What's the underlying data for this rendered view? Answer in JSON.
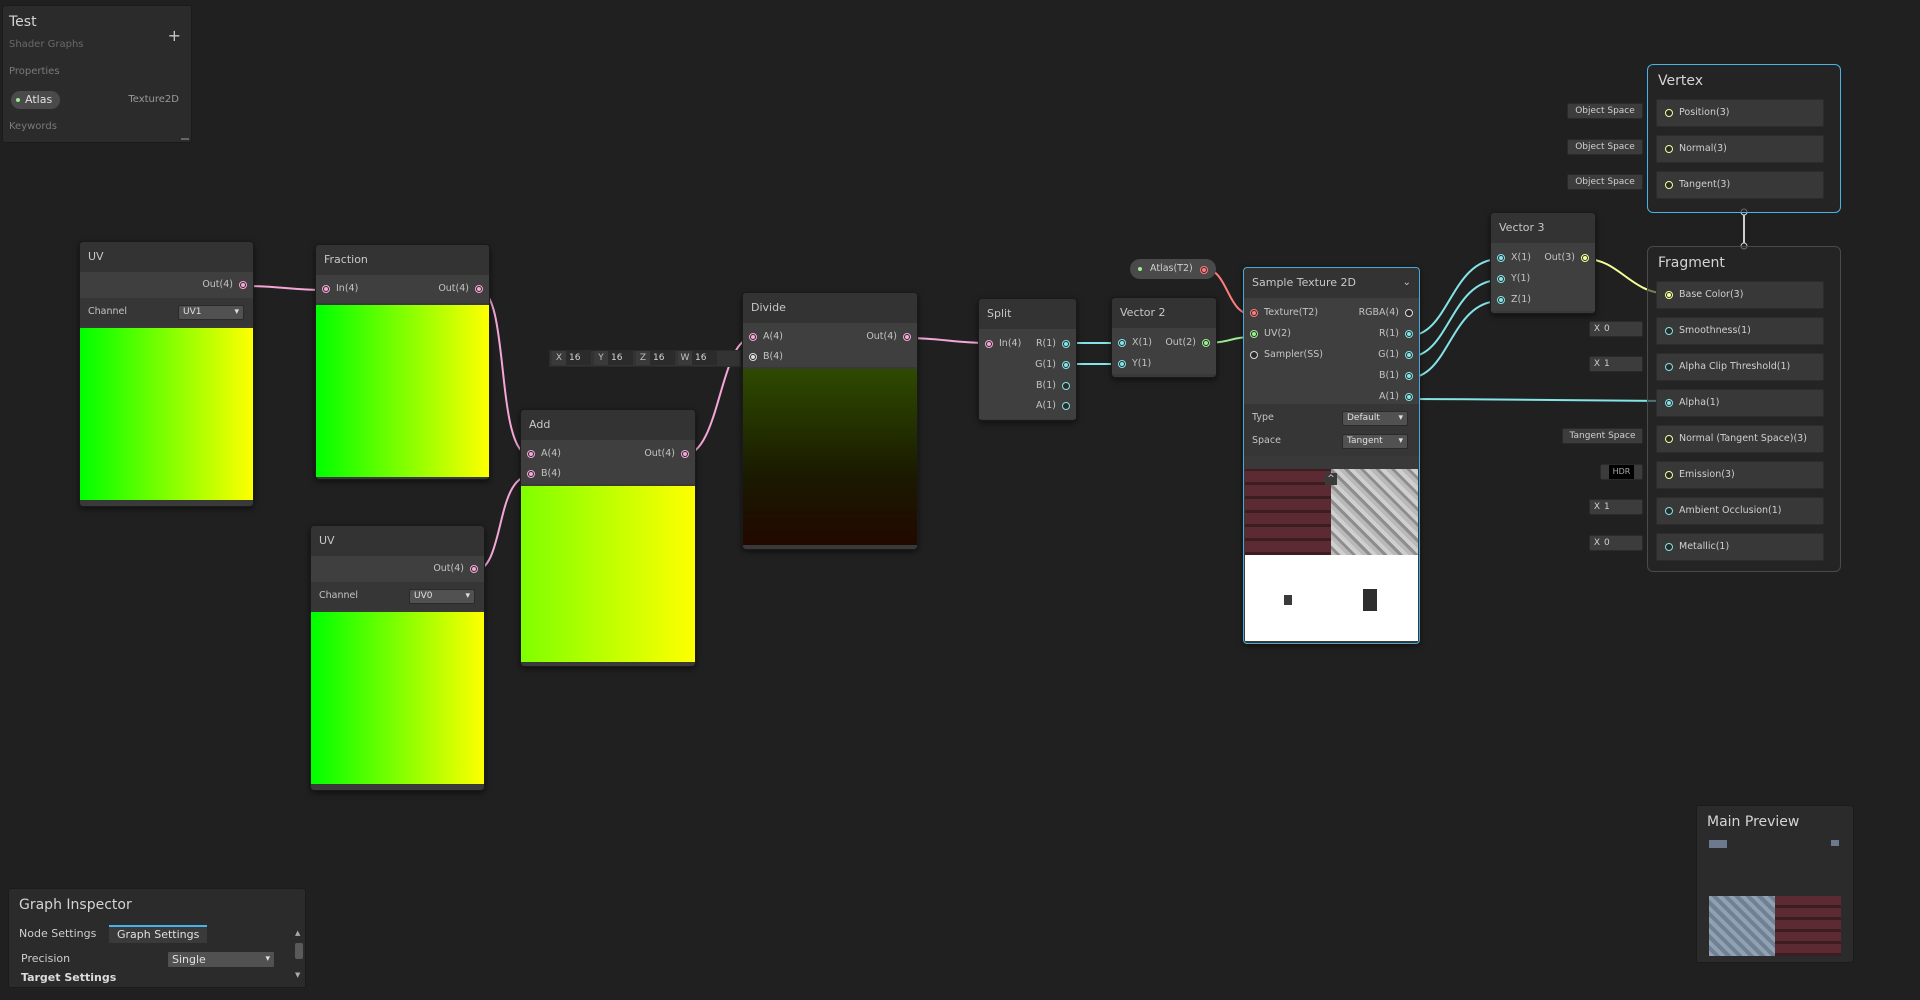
{
  "blackboard": {
    "title": "Test",
    "subtitle": "Shader Graphs",
    "add_symbol": "+",
    "properties_label": "Properties",
    "property_name": "Atlas",
    "property_type": "Texture2D",
    "keywords_label": "Keywords"
  },
  "nodes": {
    "uv1": {
      "title": "UV",
      "out": "Out(4)",
      "channel_label": "Channel",
      "channel_value": "UV1"
    },
    "uv0": {
      "title": "UV",
      "out": "Out(4)",
      "channel_label": "Channel",
      "channel_value": "UV0"
    },
    "fraction": {
      "title": "Fraction",
      "in": "In(4)",
      "out": "Out(4)"
    },
    "add": {
      "title": "Add",
      "a": "A(4)",
      "b": "B(4)",
      "out": "Out(4)"
    },
    "divide": {
      "title": "Divide",
      "a": "A(4)",
      "b": "B(4)",
      "out": "Out(4)"
    },
    "divide_b_default": {
      "x_label": "X",
      "x": "16",
      "y_label": "Y",
      "y": "16",
      "z_label": "Z",
      "z": "16",
      "w_label": "W",
      "w": "16"
    },
    "split": {
      "title": "Split",
      "in": "In(4)",
      "r": "R(1)",
      "g": "G(1)",
      "b": "B(1)",
      "a": "A(1)"
    },
    "vector2": {
      "title": "Vector 2",
      "x": "X(1)",
      "y": "Y(1)",
      "out": "Out(2)"
    },
    "atlas_property": {
      "label": "Atlas(T2)"
    },
    "sample_texture": {
      "title": "Sample Texture 2D",
      "texture": "Texture(T2)",
      "uv": "UV(2)",
      "sampler": "Sampler(SS)",
      "rgba": "RGBA(4)",
      "r": "R(1)",
      "g": "G(1)",
      "b": "B(1)",
      "a": "A(1)",
      "type_label": "Type",
      "type_value": "Default",
      "space_label": "Space",
      "space_value": "Tangent"
    },
    "vector3": {
      "title": "Vector 3",
      "x": "X(1)",
      "y": "Y(1)",
      "z": "Z(1)",
      "out": "Out(3)"
    }
  },
  "vertex": {
    "title": "Vertex",
    "slots": [
      {
        "label": "Position(3)",
        "inline": "Object Space"
      },
      {
        "label": "Normal(3)",
        "inline": "Object Space"
      },
      {
        "label": "Tangent(3)",
        "inline": "Object Space"
      }
    ]
  },
  "fragment": {
    "title": "Fragment",
    "slots": [
      {
        "label": "Base Color(3)",
        "inline": ""
      },
      {
        "label": "Smoothness(1)",
        "inline_axis": "X",
        "inline": "0"
      },
      {
        "label": "Alpha Clip Threshold(1)",
        "inline_axis": "X",
        "inline": "1"
      },
      {
        "label": "Alpha(1)",
        "inline": ""
      },
      {
        "label": "Normal (Tangent Space)(3)",
        "inline": "Tangent Space"
      },
      {
        "label": "Emission(3)",
        "inline": "HDR"
      },
      {
        "label": "Ambient Occlusion(1)",
        "inline_axis": "X",
        "inline": "1"
      },
      {
        "label": "Metallic(1)",
        "inline_axis": "X",
        "inline": "0"
      }
    ]
  },
  "inspector": {
    "title": "Graph Inspector",
    "tabs": [
      "Node Settings",
      "Graph Settings"
    ],
    "precision_label": "Precision",
    "precision_value": "Single",
    "target_settings_label": "Target Settings"
  },
  "main_preview": {
    "title": "Main Preview"
  },
  "colors": {
    "selection": "#47b3e8",
    "vector4": "#f4a6d7",
    "float": "#84e4e7",
    "vector2": "#9aef92",
    "vector3": "#f6ff9a",
    "texture": "#ff7d7d"
  }
}
